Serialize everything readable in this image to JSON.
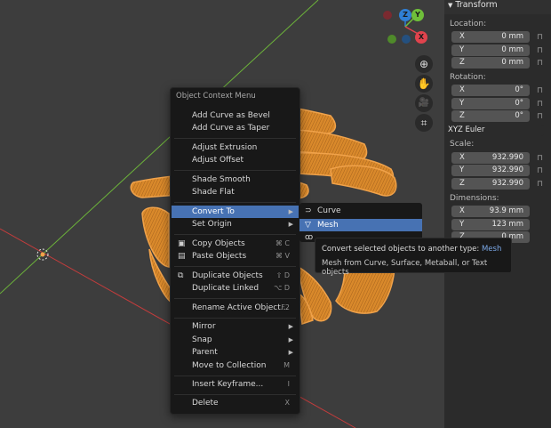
{
  "gizmo": {
    "z_label": "Z",
    "y_label": "Y",
    "x_label": "X"
  },
  "nav_tools": [
    {
      "name": "zoom-icon",
      "glyph": "⊕"
    },
    {
      "name": "hand-pan-icon",
      "glyph": "✋"
    },
    {
      "name": "camera-icon",
      "glyph": "🎥"
    },
    {
      "name": "grid-perspective-icon",
      "glyph": "⌗"
    }
  ],
  "panel": {
    "header": "Transform",
    "location_label": "Location:",
    "location": [
      {
        "axis": "X",
        "value": "0 mm"
      },
      {
        "axis": "Y",
        "value": "0 mm"
      },
      {
        "axis": "Z",
        "value": "0 mm"
      }
    ],
    "rotation_label": "Rotation:",
    "rotation": [
      {
        "axis": "X",
        "value": "0°"
      },
      {
        "axis": "Y",
        "value": "0°"
      },
      {
        "axis": "Z",
        "value": "0°"
      }
    ],
    "rotation_mode": "XYZ Euler",
    "scale_label": "Scale:",
    "scale": [
      {
        "axis": "X",
        "value": "932.990"
      },
      {
        "axis": "Y",
        "value": "932.990"
      },
      {
        "axis": "Z",
        "value": "932.990"
      }
    ],
    "dimensions_label": "Dimensions:",
    "dimensions": [
      {
        "axis": "X",
        "value": "93.9 mm"
      },
      {
        "axis": "Y",
        "value": "123 mm"
      },
      {
        "axis": "Z",
        "value": "0 mm"
      }
    ]
  },
  "context_menu": {
    "title": "Object Context Menu",
    "items": [
      {
        "label": "Add Curve as Bevel",
        "shortcut": ""
      },
      {
        "label": "Add Curve as Taper",
        "shortcut": ""
      },
      {
        "label": "Adjust Extrusion",
        "shortcut": ""
      },
      {
        "label": "Adjust Offset",
        "shortcut": ""
      },
      {
        "label": "Shade Smooth",
        "shortcut": ""
      },
      {
        "label": "Shade Flat",
        "shortcut": ""
      },
      {
        "label": "Convert To",
        "shortcut": ""
      },
      {
        "label": "Set Origin",
        "shortcut": ""
      },
      {
        "label": "Copy Objects",
        "shortcut": "⌘ C"
      },
      {
        "label": "Paste Objects",
        "shortcut": "⌘ V"
      },
      {
        "label": "Duplicate Objects",
        "shortcut": "⇧ D"
      },
      {
        "label": "Duplicate Linked",
        "shortcut": "⌥ D"
      },
      {
        "label": "Rename Active Object...",
        "shortcut": "F2"
      },
      {
        "label": "Mirror",
        "shortcut": ""
      },
      {
        "label": "Snap",
        "shortcut": ""
      },
      {
        "label": "Parent",
        "shortcut": ""
      },
      {
        "label": "Move to Collection",
        "shortcut": "M"
      },
      {
        "label": "Insert Keyframe...",
        "shortcut": "I"
      },
      {
        "label": "Delete",
        "shortcut": "X"
      }
    ]
  },
  "convert_submenu": {
    "items": [
      {
        "label": "Curve"
      },
      {
        "label": "Mesh"
      }
    ]
  },
  "tooltip": {
    "line1_prefix": "Convert selected objects to another type:",
    "line1_value": "Mesh",
    "line2": "Mesh from Curve, Surface, Metaball, or Text objects"
  },
  "colors": {
    "accent": "#4772b3",
    "object_orange": "#d9892b",
    "x_axis": "#c23c3c",
    "y_axis": "#6cb33a",
    "gizmo_z": "#2f7fd4",
    "gizmo_y": "#6fbf3a",
    "gizmo_x": "#e0434d"
  }
}
